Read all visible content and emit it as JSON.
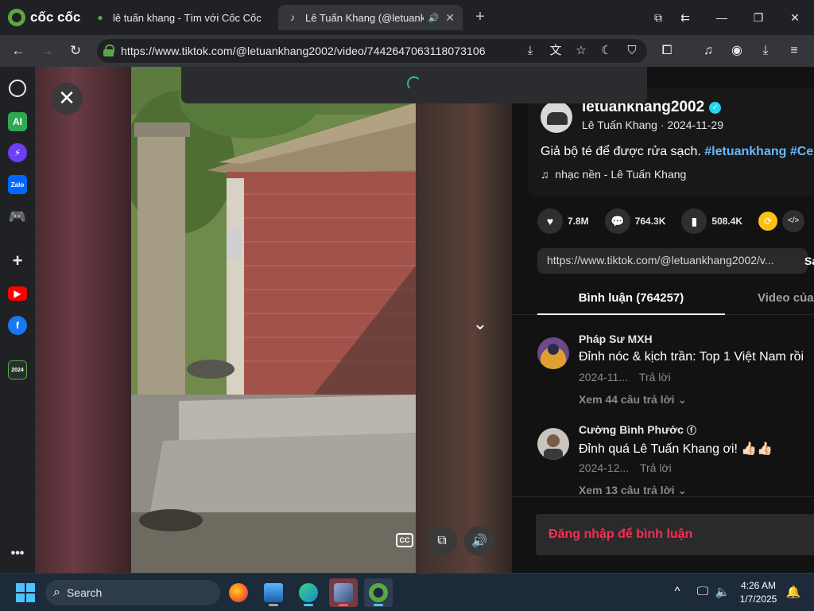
{
  "browser": {
    "brand": "cốc cốc",
    "tabs": [
      {
        "title": "lê tuấn khang - Tìm với Cốc Cốc",
        "active": false
      },
      {
        "title": "Lê Tuấn Khang (@letuankhang",
        "active": true
      }
    ],
    "url": "https://www.tiktok.com/@letuankhang2002/video/7442647063118073106"
  },
  "video": {
    "cc_label": "CC"
  },
  "post": {
    "username": "letuankhang2002",
    "display_name": "Lê Tuấn Khang",
    "date": "2024-11-29",
    "meta_line": "Lê Tuấn Khang · 2024-11-29",
    "description": "Giả bộ té để được rửa sạch.",
    "hashtags": "#letuankhang #Ce",
    "music": "nhạc nền - Lê Tuấn Khang",
    "likes": "7.8M",
    "comments": "764.3K",
    "saves": "508.4K",
    "share_url": "https://www.tiktok.com/@letuankhang2002/v...",
    "copy_label": "Sa",
    "tab_comments": "Bình luận (764257)",
    "tab_creator_videos": "Video của n",
    "login_prompt": "Đăng nhập để bình luận"
  },
  "comment_list": [
    {
      "author": "Pháp Sư MXH",
      "text": "Đỉnh nóc & kịch trần: Top 1 Việt Nam rồi",
      "date": "2024-11...",
      "reply_label": "Trả lời",
      "replies": "Xem 44 câu trả lời ⌄"
    },
    {
      "author": "Cường Bình Phước",
      "text": "Đỉnh quá Lê Tuấn Khang ơi! 👍🏻👍🏻",
      "date": "2024-12...",
      "reply_label": "Trả lời",
      "replies": "Xem 13 câu trả lời ⌄"
    }
  ],
  "taskbar": {
    "search_placeholder": "Search",
    "time": "4:26 AM",
    "date": "1/7/2025"
  },
  "colors": {
    "accent_teal": "#2fb3a9",
    "tiktok_red": "#fe2c55",
    "hashtag_blue": "#68b8ff",
    "verified": "#20d5ec"
  }
}
